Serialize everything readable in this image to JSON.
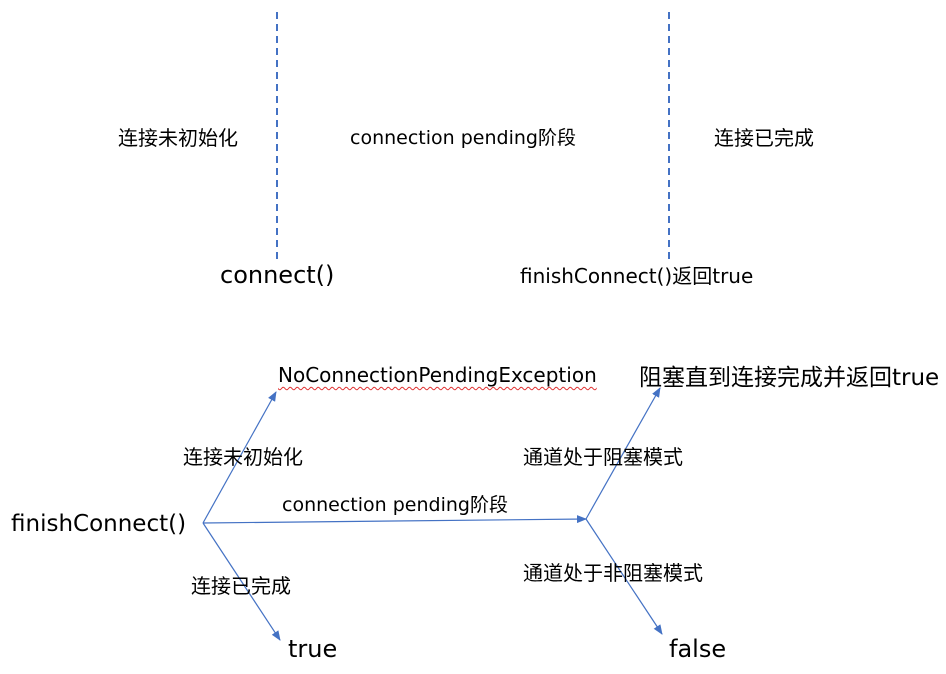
{
  "colors": {
    "line": "#4472c4",
    "text": "#000000",
    "spellcheck": "#e03030"
  },
  "top": {
    "state_uninit": "连接未初始化",
    "state_pending": "connection pending阶段",
    "state_done": "连接已完成",
    "call_connect": "connect()",
    "call_finish": "finishConnect()返回true"
  },
  "flow": {
    "start": "finishConnect()",
    "branch_uninit_label": "连接未初始化",
    "branch_pending_label": "connection pending阶段",
    "branch_done_label": "连接已完成",
    "exception_result": "NoConnectionPendingException",
    "done_result": "true",
    "blocking_label": "通道处于阻塞模式",
    "blocking_result": "阻塞直到连接完成并返回true",
    "nonblocking_label": "通道处于非阻塞模式",
    "nonblocking_result": "false"
  }
}
